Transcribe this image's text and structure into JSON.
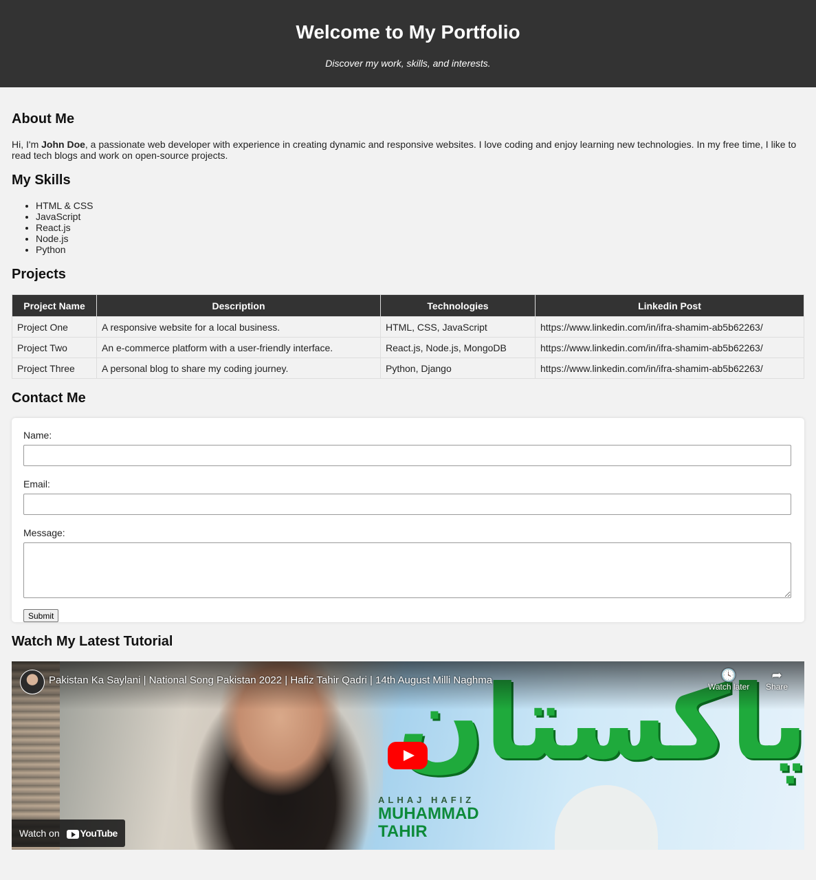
{
  "header": {
    "title": "Welcome to My Portfolio",
    "subtitle": "Discover my work, skills, and interests."
  },
  "about": {
    "heading": "About Me",
    "text_before": "Hi, I'm ",
    "name": "John Doe",
    "text_after": ", a passionate web developer with experience in creating dynamic and responsive websites. I love coding and enjoy learning new technologies. In my free time, I like to read tech blogs and work on open-source projects."
  },
  "skills": {
    "heading": "My Skills",
    "items": [
      "HTML & CSS",
      "JavaScript",
      "React.js",
      "Node.js",
      "Python"
    ]
  },
  "projects": {
    "heading": "Projects",
    "columns": [
      "Project Name",
      "Description",
      "Technologies",
      "Linkedin Post"
    ],
    "rows": [
      [
        "Project One",
        "A responsive website for a local business.",
        "HTML, CSS, JavaScript",
        "https://www.linkedin.com/in/ifra-shamim-ab5b62263/"
      ],
      [
        "Project Two",
        "An e-commerce platform with a user-friendly interface.",
        "React.js, Node.js, MongoDB",
        "https://www.linkedin.com/in/ifra-shamim-ab5b62263/"
      ],
      [
        "Project Three",
        "A personal blog to share my coding journey.",
        "Python, Django",
        "https://www.linkedin.com/in/ifra-shamim-ab5b62263/"
      ]
    ]
  },
  "contact": {
    "heading": "Contact Me",
    "name_label": "Name:",
    "name_value": "",
    "email_label": "Email:",
    "email_value": "",
    "message_label": "Message:",
    "message_value": "",
    "submit_label": "Submit"
  },
  "tutorial": {
    "heading": "Watch My Latest Tutorial",
    "video_title": "Pakistan Ka Saylani | National Song Pakistan 2022 | Hafiz Tahir Qadri | 14th August Milli Naghma",
    "watch_later": "Watch later",
    "share": "Share",
    "watch_on": "Watch on",
    "youtube": "YouTube",
    "overlay_small": "ALHAJ HAFIZ",
    "overlay_name1": "MUHAMMAD",
    "overlay_name2": "TAHIR",
    "overlay_urdu": "پاکستان"
  },
  "colors": {
    "header_bg": "#333333",
    "page_bg": "#f2f2f2",
    "play_button": "#ff0000"
  }
}
